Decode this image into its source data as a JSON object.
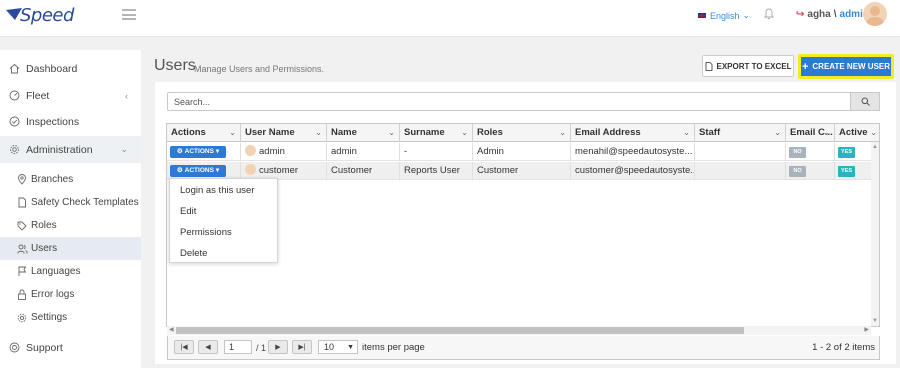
{
  "header": {
    "logo_text": "Speed",
    "language": "English",
    "user_prefix": "agha",
    "user_suffix": "admin"
  },
  "sidebar": {
    "items": [
      {
        "label": "Dashboard",
        "icon": "home-icon"
      },
      {
        "label": "Fleet",
        "icon": "gauge-icon"
      },
      {
        "label": "Inspections",
        "icon": "check-circle-icon"
      },
      {
        "label": "Administration",
        "icon": "gear-icon"
      },
      {
        "label": "Branches",
        "icon": "map-pin-icon"
      },
      {
        "label": "Safety Check Templates",
        "icon": "document-icon"
      },
      {
        "label": "Roles",
        "icon": "tag-icon"
      },
      {
        "label": "Users",
        "icon": "users-icon"
      },
      {
        "label": "Languages",
        "icon": "flag-icon"
      },
      {
        "label": "Error logs",
        "icon": "lock-icon"
      },
      {
        "label": "Settings",
        "icon": "gear-icon"
      },
      {
        "label": "Support",
        "icon": "support-icon"
      }
    ]
  },
  "main": {
    "title": "Users",
    "subtitle": "Manage Users and Permissions.",
    "export_label": "EXPORT TO EXCEL",
    "create_label": "CREATE NEW USER",
    "search_placeholder": "Search..."
  },
  "table": {
    "columns": [
      "Actions",
      "User Name",
      "Name",
      "Surname",
      "Roles",
      "Email Address",
      "Staff",
      "Email C...",
      "Active"
    ],
    "actions_label": "ACTIONS",
    "rows": [
      {
        "username": "admin",
        "name": "admin",
        "surname": "-",
        "roles": "Admin",
        "email": "menahil@speedautosyste...",
        "staff": "",
        "email_confirmed": "NO",
        "active": "YES"
      },
      {
        "username": "customer",
        "name": "Customer",
        "surname": "Reports User",
        "roles": "Customer",
        "email": "customer@speedautosyste...",
        "staff": "",
        "email_confirmed": "NO",
        "active": "YES"
      }
    ]
  },
  "actions_menu": {
    "items": [
      "Login as this user",
      "Edit",
      "Permissions",
      "Delete"
    ]
  },
  "pager": {
    "page": "1",
    "of_text": "/ 1",
    "page_size": "10",
    "items_per_page_label": "items per page",
    "info": "1 - 2 of 2 items"
  },
  "colors": {
    "accent": "#2b7ad3",
    "highlight_border": "#f4ea2a",
    "badge_yes": "#2bb3c0",
    "badge_no": "#a8b3bd"
  }
}
